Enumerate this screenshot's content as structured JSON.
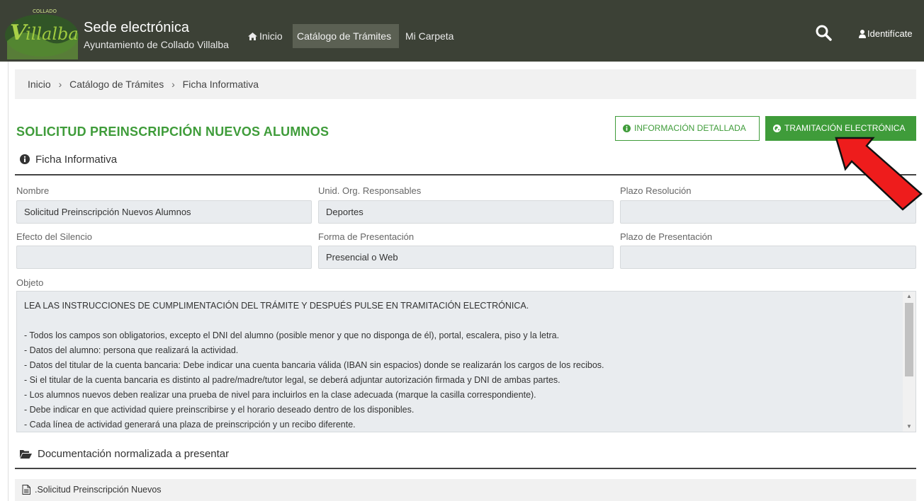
{
  "header": {
    "logo_text": "Villalba",
    "brand_title": "Sede electrónica",
    "brand_subtitle": "Ayuntamiento de Collado Villalba",
    "nav": [
      {
        "label": "Inicio"
      },
      {
        "label": "Catálogo de Trámites"
      },
      {
        "label": "Mi Carpeta"
      }
    ],
    "user_label": "Identifícate"
  },
  "breadcrumb": {
    "items": [
      "Inicio",
      "Catálogo de Trámites",
      "Ficha Informativa"
    ],
    "separator": "›"
  },
  "page": {
    "title": "SOLICITUD PREINSCRIPCIÓN NUEVOS ALUMNOS",
    "btn_info": "Información detallada",
    "btn_tramitacion": "Tramitación electrónica",
    "section_ficha": "Ficha Informativa",
    "section_doc": "Documentación normalizada a presentar"
  },
  "fields": {
    "nombre": {
      "label": "Nombre",
      "value": "Solicitud Preinscripción Nuevos Alumnos"
    },
    "unid": {
      "label": "Unid. Org. Responsables",
      "value": "Deportes"
    },
    "plazo_res": {
      "label": "Plazo Resolución",
      "value": ""
    },
    "efecto": {
      "label": "Efecto del Silencio",
      "value": ""
    },
    "forma": {
      "label": "Forma de Presentación",
      "value": "Presencial o Web"
    },
    "plazo_pres": {
      "label": "Plazo de Presentación",
      "value": ""
    }
  },
  "objeto": {
    "label": "Objeto",
    "intro": "LEA LAS INSTRUCCIONES DE CUMPLIMENTACIÓN DEL TRÁMITE Y DESPUÉS PULSE EN TRAMITACIÓN ELECTRÓNICA.",
    "lines": [
      "- Todos los campos son obligatorios, excepto el DNI del alumno (posible menor y que no disponga de él), portal, escalera, piso y la letra.",
      "- Datos del alumno: persona que realizará la actividad.",
      "- Datos del titular de la cuenta bancaria: Debe indicar una cuenta bancaria válida (IBAN sin espacios) donde se realizarán los cargos de los recibos.",
      "- Si el titular de la cuenta bancaria es distinto al padre/madre/tutor legal, se deberá adjuntar autorización firmada y DNI de ambas partes.",
      "- Los alumnos nuevos deben realizar una prueba de nivel para incluirlos en la clase adecuada (marque la casilla correspondiente).",
      "- Debe indicar en que actividad quiere preinscribirse y el horario deseado dentro de los disponibles.",
      "- Cada línea de actividad generará una plaza de preinscripción y un recibo diferente."
    ]
  },
  "documents": [
    {
      "label": ".Solicitud Preinscripción Nuevos"
    }
  ],
  "colors": {
    "navbar": "#3c4136",
    "accent_green": "#3f9c3a",
    "field_bg": "#e9ecef",
    "arrow_red": "#ee1c1c"
  },
  "icons": [
    "home-icon",
    "search-icon",
    "user-icon",
    "info-circle-icon",
    "globe-icon",
    "folder-open-icon",
    "file-text-icon",
    "red-arrow"
  ]
}
